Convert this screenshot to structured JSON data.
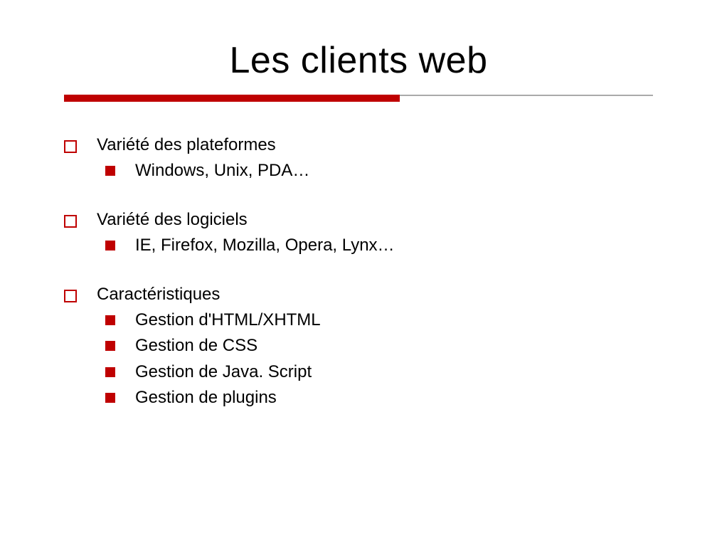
{
  "title": "Les clients web",
  "sections": [
    {
      "heading": "Variété des plateformes",
      "items": [
        "Windows, Unix, PDA…"
      ]
    },
    {
      "heading": "Variété des logiciels",
      "items": [
        "IE, Firefox, Mozilla, Opera, Lynx…"
      ]
    },
    {
      "heading": "Caractéristiques",
      "items": [
        "Gestion d'HTML/XHTML",
        "Gestion de CSS",
        "Gestion de Java. Script",
        "Gestion de plugins"
      ]
    }
  ]
}
